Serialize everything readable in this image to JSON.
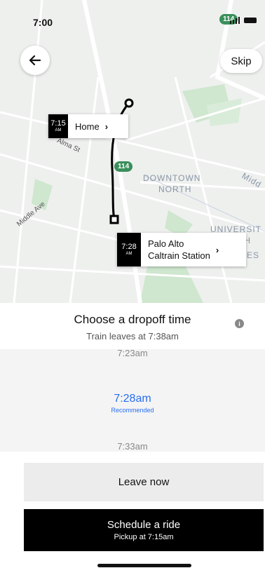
{
  "status": {
    "time": "7:00"
  },
  "map": {
    "highway_badge_top": "114",
    "highway_badge_mid": "114",
    "area_labels": {
      "downtown": "DOWNTOWN",
      "north": "NORTH",
      "university": "UNIVERSIT",
      "th": "TH",
      "es": "ES",
      "midd": "Midd"
    },
    "streets": {
      "alma": "Alma St",
      "middle": "Middle Ave"
    }
  },
  "header": {
    "skip_label": "Skip"
  },
  "stops": {
    "home": {
      "time": "7:15",
      "ampm": "AM",
      "name": "Home",
      "chevron": "›"
    },
    "station": {
      "time": "7:28",
      "ampm": "AM",
      "name_line1": "Palo Alto",
      "name_line2": "Caltrain Station",
      "chevron": "›"
    }
  },
  "panel": {
    "title": "Choose a dropoff time",
    "subtitle": "Train leaves at 7:38am",
    "info": "i"
  },
  "picker": {
    "above": "7:23am",
    "selected": "7:28am",
    "selected_note": "Recommended",
    "below": "7:33am"
  },
  "actions": {
    "leave_now": "Leave now",
    "schedule": "Schedule a ride",
    "schedule_sub": "Pickup at 7:15am"
  },
  "colors": {
    "accent": "#276ef1",
    "map_bg": "#eef0ee",
    "park": "#cfe6cf",
    "highway": "#3a8f5b"
  }
}
